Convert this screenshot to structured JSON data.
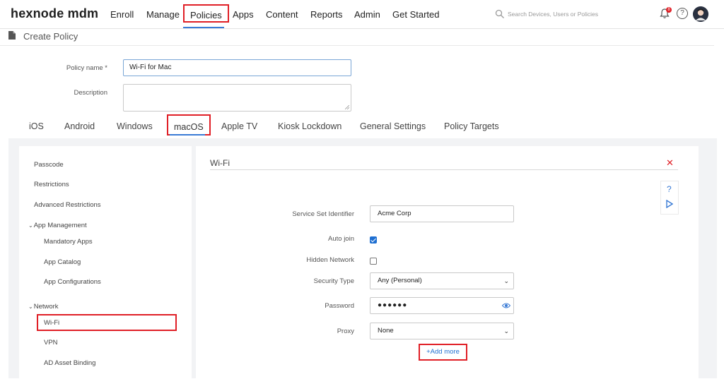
{
  "brand": {
    "logo_text": "hexnode mdm"
  },
  "nav": {
    "items": [
      {
        "label": "Enroll"
      },
      {
        "label": "Manage"
      },
      {
        "label": "Policies",
        "active": true
      },
      {
        "label": "Apps"
      },
      {
        "label": "Content"
      },
      {
        "label": "Reports"
      },
      {
        "label": "Admin"
      },
      {
        "label": "Get Started"
      }
    ],
    "search_placeholder": "Search Devices, Users or Policies",
    "notification_count": "8",
    "help_glyph": "?"
  },
  "page": {
    "title": "Create Policy"
  },
  "form": {
    "policy_name_label": "Policy name *",
    "policy_name_value": "Wi-Fi for Mac",
    "description_label": "Description",
    "description_value": ""
  },
  "platform_tabs": [
    {
      "label": "iOS"
    },
    {
      "label": "Android"
    },
    {
      "label": "Windows"
    },
    {
      "label": "macOS",
      "active": true
    },
    {
      "label": "Apple TV"
    },
    {
      "label": "Kiosk Lockdown"
    },
    {
      "label": "General Settings"
    },
    {
      "label": "Policy Targets"
    }
  ],
  "sidebar": {
    "items": [
      {
        "label": "Passcode"
      },
      {
        "label": "Restrictions"
      },
      {
        "label": "Advanced Restrictions"
      },
      {
        "label": "App Management",
        "group": true
      },
      {
        "label": "Mandatory Apps"
      },
      {
        "label": "App Catalog"
      },
      {
        "label": "App Configurations"
      },
      {
        "label": "Network",
        "group": true
      },
      {
        "label": "Wi-Fi",
        "active": true
      },
      {
        "label": "VPN"
      },
      {
        "label": "AD Asset Binding"
      }
    ]
  },
  "wifi": {
    "section_title": "Wi-Fi",
    "close_glyph": "✕",
    "help_glyph": "?",
    "ssid_label": "Service Set Identifier",
    "ssid_value": "Acme Corp",
    "auto_join_label": "Auto join",
    "auto_join_checked": true,
    "hidden_network_label": "Hidden Network",
    "hidden_network_checked": false,
    "security_type_label": "Security Type",
    "security_type_value": "Any (Personal)",
    "password_label": "Password",
    "password_mask": "●●●●●●",
    "proxy_label": "Proxy",
    "proxy_value": "None",
    "add_more_label": "+Add more"
  },
  "colors": {
    "highlight_red": "#e01f26",
    "accent_blue": "#1f6fd1",
    "panel_bg": "#f2f3f5"
  },
  "icons": [
    "file-icon",
    "search-icon",
    "bell-icon",
    "help-icon",
    "avatar-icon",
    "chevron-down-icon",
    "close-icon",
    "play-icon",
    "eye-icon"
  ]
}
